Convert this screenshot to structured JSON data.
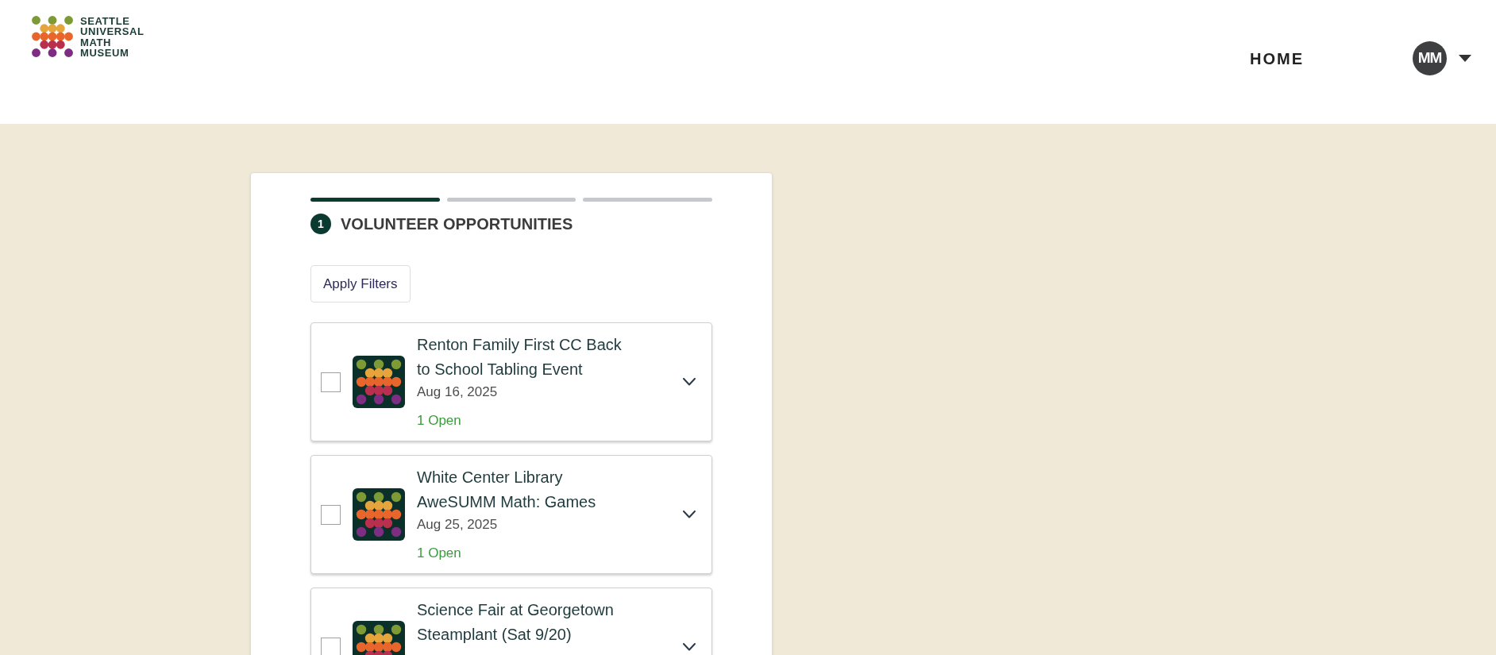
{
  "header": {
    "logo": {
      "wordmark": "SEATTLE UNIVERSAL MATH MUSEUM"
    },
    "nav": [
      {
        "label": "HOME"
      }
    ],
    "user": {
      "initials": "MM"
    }
  },
  "wizard": {
    "steps": [
      {
        "selected": true
      },
      {
        "selected": false
      },
      {
        "selected": false
      }
    ],
    "current_step": {
      "number": "1",
      "title": "VOLUNTEER OPPORTUNITIES"
    },
    "filter_button": "Apply Filters",
    "opportunities": [
      {
        "title": "Renton Family First CC Back to School Tabling Event",
        "date": "Aug 16, 2025",
        "openings": "1 Open",
        "checked": false,
        "expanded": false
      },
      {
        "title": "White Center Library AweSUMM Math: Games",
        "date": "Aug 25, 2025",
        "openings": "1 Open",
        "checked": false,
        "expanded": false
      },
      {
        "title": "Science Fair at Georgetown Steamplant (Sat 9/20)",
        "checked": false,
        "expanded": false
      }
    ]
  }
}
